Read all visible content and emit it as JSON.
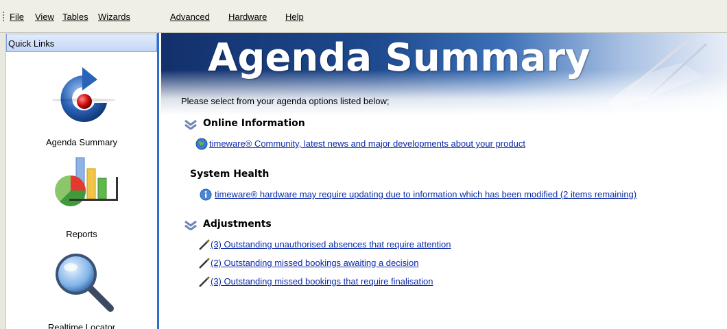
{
  "menu": {
    "items": [
      "File",
      "View",
      "Tables",
      "Wizards",
      "Advanced",
      "Hardware",
      "Help"
    ]
  },
  "quick_links": {
    "title": "Quick Links",
    "items": [
      {
        "label": "Agenda Summary",
        "icon": "agenda-summary-icon"
      },
      {
        "label": "Reports",
        "icon": "reports-chart-icon"
      },
      {
        "label": "Realtime Locator",
        "icon": "magnifier-icon"
      }
    ]
  },
  "main": {
    "banner_title": "Agenda Summary",
    "intro": "Please select from your agenda options listed below;",
    "sections": {
      "online": {
        "title": "Online Information",
        "links": [
          "timeware® Community, latest news and major developments about your product"
        ]
      },
      "health": {
        "title": "System Health",
        "links": [
          "timeware® hardware may require updating due to information which has been modified (2 items remaining)"
        ]
      },
      "adjustments": {
        "title": "Adjustments",
        "links": [
          "(3) Outstanding unauthorised absences that require attention",
          "(2) Outstanding missed bookings awaiting a decision",
          "(3) Outstanding missed bookings that require finalisation"
        ]
      }
    }
  },
  "colors": {
    "accent": "#2f6fc9",
    "link": "#0b2aa8",
    "menubar": "#f0efe6"
  }
}
